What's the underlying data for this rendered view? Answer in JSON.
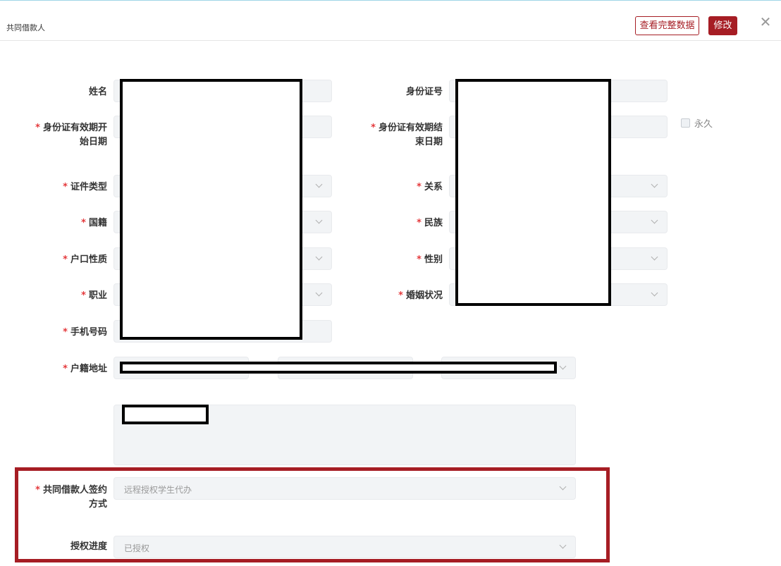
{
  "header": {
    "title": "共同借款人",
    "view_full_label": "查看完整数据",
    "edit_label": "修改",
    "close_glyph": "✕"
  },
  "form": {
    "required_mark": "*",
    "name_label": "姓名",
    "id_number_label": "身份证号",
    "id_start_label_1": "身份证有效期开",
    "id_start_label_2": "始日期",
    "id_end_label_1": "身份证有效期结",
    "id_end_label_2": "束日期",
    "permanent_label": "永久",
    "doc_type_label": "证件类型",
    "relation_label": "关系",
    "nationality_label": "国籍",
    "ethnicity_label": "民族",
    "hukou_type_label": "户口性质",
    "gender_label": "性别",
    "occupation_label": "职业",
    "marital_label": "婚姻状况",
    "phone_label": "手机号码",
    "address_label": "户籍地址",
    "sign_method_label_1": "共同借款人签约",
    "sign_method_label_2": "方式",
    "sign_method_value": "远程授权学生代办",
    "auth_progress_label": "授权进度",
    "auth_progress_value": "已授权"
  },
  "colors": {
    "brand": "#a61d24",
    "required": "#e4393c",
    "field_bg": "#f2f4f6"
  }
}
